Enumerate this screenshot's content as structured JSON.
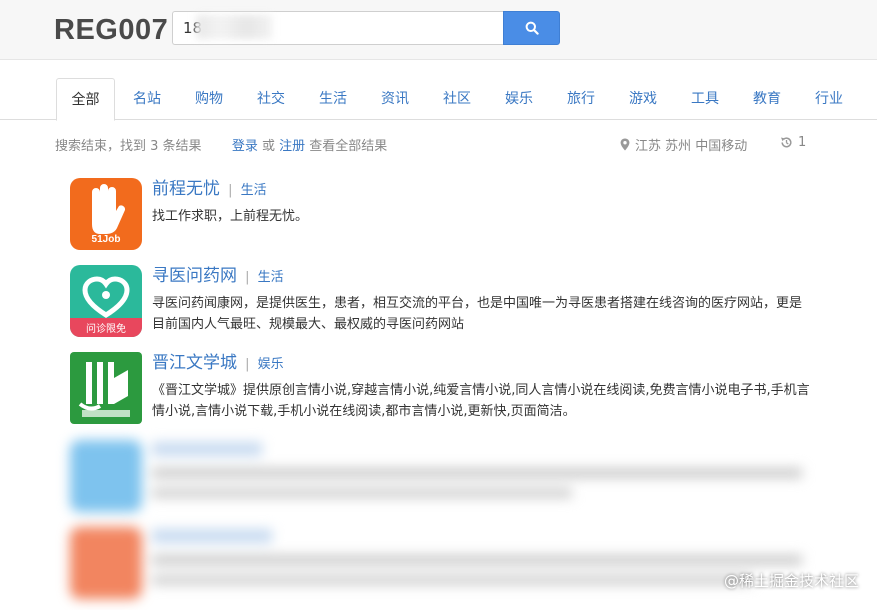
{
  "header": {
    "logo": "REG007",
    "search_value": "18"
  },
  "tabs": [
    {
      "label": "全部",
      "active": true
    },
    {
      "label": "名站"
    },
    {
      "label": "购物"
    },
    {
      "label": "社交"
    },
    {
      "label": "生活"
    },
    {
      "label": "资讯"
    },
    {
      "label": "社区"
    },
    {
      "label": "娱乐"
    },
    {
      "label": "旅行"
    },
    {
      "label": "游戏"
    },
    {
      "label": "工具"
    },
    {
      "label": "教育"
    },
    {
      "label": "行业"
    }
  ],
  "stats": {
    "summary": "搜索结束，找到 3 条结果",
    "login": "登录",
    "or": "或",
    "register": "注册",
    "suffix": "查看全部结果",
    "location": "江苏 苏州 中国移动",
    "history_count": "1"
  },
  "results": [
    {
      "title": "前程无忧",
      "sep": "|",
      "category": "生活",
      "desc": "找工作求职，上前程无忧。",
      "icon_text": "51Job",
      "icon_color": "#f26b1d"
    },
    {
      "title": "寻医问药网",
      "sep": "|",
      "category": "生活",
      "desc": "寻医问药闻康网，是提供医生，患者，相互交流的平台，也是中国唯一为寻医患者搭建在线咨询的医疗网站，更是目前国内人气最旺、规模最大、最权威的寻医问药网站",
      "icon_text": "问诊限免",
      "icon_color": "#2bb99b"
    },
    {
      "title": "晋江文学城",
      "sep": "|",
      "category": "娱乐",
      "desc": "《晋江文学城》提供原创言情小说,穿越言情小说,纯爱言情小说,同人言情小说在线阅读,免费言情小说电子书,手机言情小说,言情小说下载,手机小说在线阅读,都市言情小说,更新快,页面简洁。",
      "icon_color": "#2c9a3f"
    }
  ],
  "watermark": "@稀土掘金技术社区",
  "colors": {
    "link": "#3a78c3",
    "search_button": "#4a8de6"
  }
}
